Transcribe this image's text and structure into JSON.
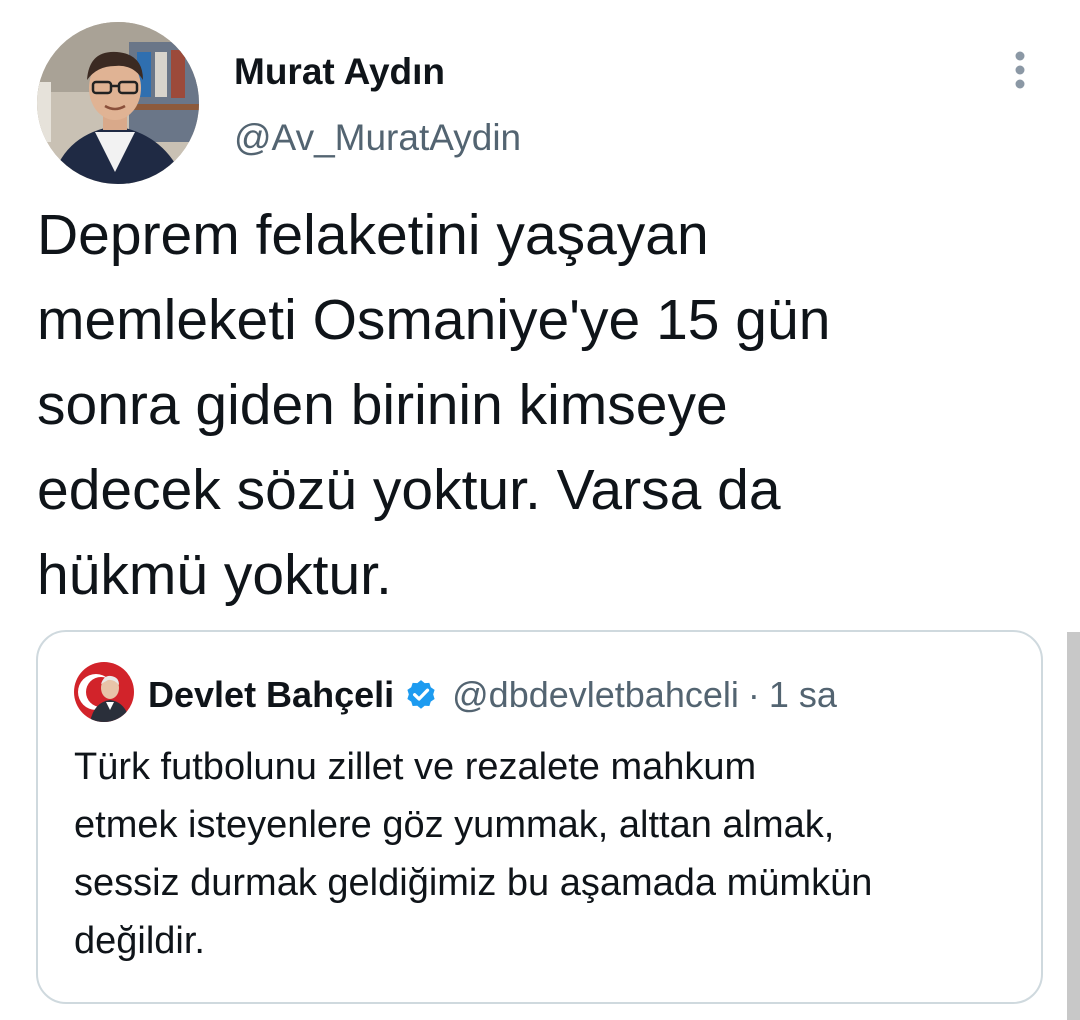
{
  "tweet": {
    "author": {
      "name": "Murat Aydın",
      "handle": "@Av_MuratAydin"
    },
    "text_lines": [
      "Deprem felaketini yaşayan",
      "memleketi Osmaniye'ye 15 gün",
      "sonra giden birinin kimseye",
      "edecek sözü yoktur. Varsa da",
      "hükmü yoktur."
    ],
    "more_icon": "more-vertical-icon"
  },
  "quoted_tweet": {
    "author": {
      "name": "Devlet Bahçeli",
      "handle": "@dbdevletbahceli",
      "verified_icon": "verified-badge-icon"
    },
    "separator": "·",
    "time": "1 sa",
    "text_lines": [
      "Türk futbolunu zillet ve rezalete mahkum",
      "etmek isteyenlere göz yummak, alttan almak,",
      "sessiz durmak geldiğimiz bu aşamada mümkün",
      "değildir."
    ]
  },
  "colors": {
    "text_primary": "#0f1419",
    "text_secondary": "#536471",
    "border": "#cfd9de",
    "verified_blue": "#1d9bf0",
    "quote_avatar_red": "#d2232a"
  }
}
